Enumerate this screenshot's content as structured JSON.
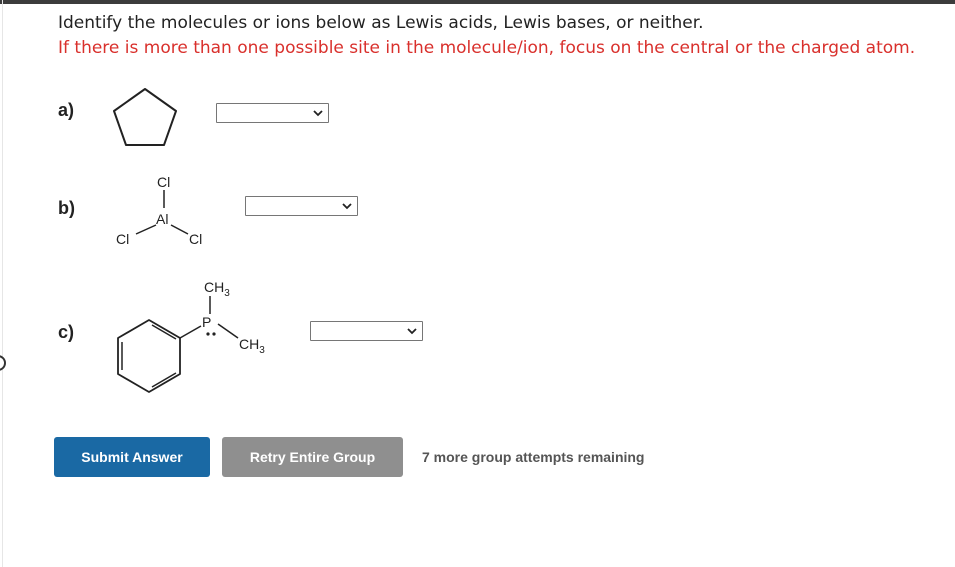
{
  "question": {
    "title": "Identify the molecules or ions below as Lewis acids, Lewis bases, or neither.",
    "note": "If there is more than one possible site in the molecule/ion, focus on the central or the charged atom."
  },
  "items": [
    {
      "label": "a)",
      "molecule": "cyclopentane",
      "selected": ""
    },
    {
      "label": "b)",
      "molecule": "aluminum-trichloride",
      "atoms": {
        "top": "Cl",
        "center": "Al",
        "left": "Cl",
        "right": "Cl"
      },
      "selected": ""
    },
    {
      "label": "c)",
      "molecule": "dimethylphenylphosphine",
      "atoms": {
        "center": "P",
        "methyl_top": "CH",
        "methyl_right": "CH",
        "subscript": "3"
      },
      "selected": ""
    }
  ],
  "buttons": {
    "submit": "Submit Answer",
    "retry": "Retry Entire Group"
  },
  "attempts_text": "7 more group attempts remaining",
  "colors": {
    "note_red": "#d9302c",
    "submit_blue": "#1a69a4",
    "retry_gray": "#8f8f8f"
  },
  "icons": {
    "dropdown": "chevron-down-icon"
  }
}
